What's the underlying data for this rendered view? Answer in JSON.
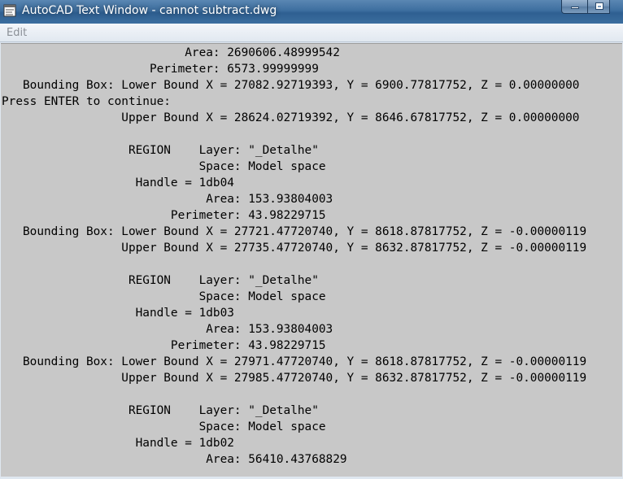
{
  "window": {
    "title": "AutoCAD Text Window - cannot subtract.dwg",
    "app_icon": "autocad-text-window-icon",
    "controls": {
      "minimize_icon": "minimize-icon",
      "maximize_icon": "maximize-icon"
    }
  },
  "menu": {
    "items": [
      "Edit"
    ]
  },
  "colors": {
    "titlebar": "#3d6e9f",
    "text_area_bg": "#c8c8c8",
    "text": "#000000",
    "menu_disabled_text": "#8a8f96"
  },
  "lines": [
    "                          Area: 2690606.48999542",
    "                     Perimeter: 6573.99999999",
    "   Bounding Box: Lower Bound X = 27082.92719393, Y = 6900.77817752, Z = 0.00000000",
    "Press ENTER to continue:",
    "                 Upper Bound X = 28624.02719392, Y = 8646.67817752, Z = 0.00000000",
    "",
    "                  REGION    Layer: \"_Detalhe\"",
    "                            Space: Model space",
    "                   Handle = 1db04",
    "                             Area: 153.93804003",
    "                        Perimeter: 43.98229715",
    "   Bounding Box: Lower Bound X = 27721.47720740, Y = 8618.87817752, Z = -0.00000119",
    "                 Upper Bound X = 27735.47720740, Y = 8632.87817752, Z = -0.00000119",
    "",
    "                  REGION    Layer: \"_Detalhe\"",
    "                            Space: Model space",
    "                   Handle = 1db03",
    "                             Area: 153.93804003",
    "                        Perimeter: 43.98229715",
    "   Bounding Box: Lower Bound X = 27971.47720740, Y = 8618.87817752, Z = -0.00000119",
    "                 Upper Bound X = 27985.47720740, Y = 8632.87817752, Z = -0.00000119",
    "",
    "                  REGION    Layer: \"_Detalhe\"",
    "                            Space: Model space",
    "                   Handle = 1db02",
    "                             Area: 56410.43768829"
  ]
}
